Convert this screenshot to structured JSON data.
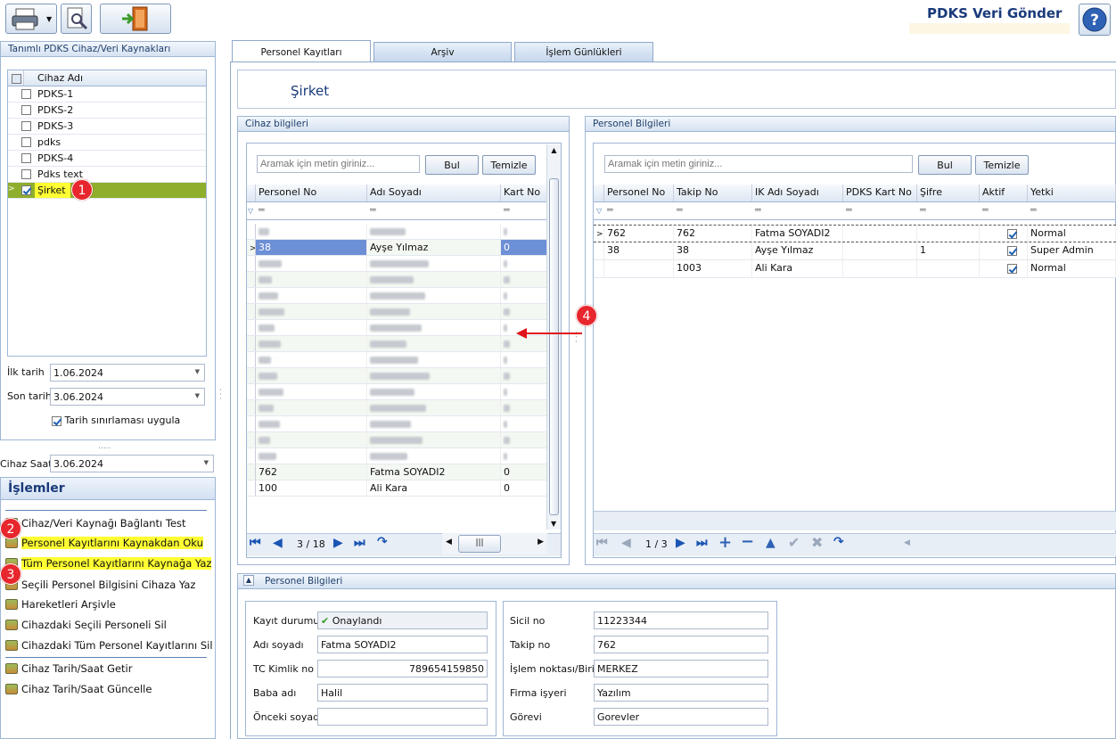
{
  "app_title": "PDKS Veri Gönder",
  "toolbar": {
    "print": "printer-icon",
    "preview": "print-preview-icon",
    "exit": "exit-door-icon",
    "help": "help-icon"
  },
  "left": {
    "panel_title": "Tanımlı PDKS Cihaz/Veri Kaynakları",
    "col_header": "Cihaz Adı",
    "devices": [
      {
        "name": "PDKS-1",
        "checked": false
      },
      {
        "name": "PDKS-2",
        "checked": false
      },
      {
        "name": "PDKS-3",
        "checked": false
      },
      {
        "name": "pdks",
        "checked": false
      },
      {
        "name": "PDKS-4",
        "checked": false
      },
      {
        "name": "Pdks text",
        "checked": false
      },
      {
        "name": "Şirket",
        "checked": true
      }
    ],
    "first_date_label": "İlk tarih",
    "first_date": "1.06.2024",
    "last_date_label": "Son tarih",
    "last_date": "3.06.2024",
    "date_limit_label": "Tarih sınırlaması uygula",
    "device_time_label": "Cihaz Saati",
    "device_time": "3.06.2024",
    "ops_title": "İşlemler",
    "ops": [
      "Cihaz/Veri Kaynağı Bağlantı Test",
      "Personel Kayıtlarını Kaynakdan Oku",
      "Tüm Personel Kayıtlarını Kaynağa Yaz",
      "Seçili Personel Bilgisini Cihaza Yaz",
      "Hareketleri Arşivle",
      "Cihazdaki Seçili Personeli Sil",
      "Cihazdaki Tüm Personel Kayıtlarını Sil",
      "Cihaz Tarih/Saat Getir",
      "Cihaz Tarih/Saat Güncelle"
    ]
  },
  "tabs": [
    "Personel Kayıtları",
    "Arşiv",
    "İşlem Günlükleri"
  ],
  "company": "Şirket",
  "device_panel": {
    "title": "Cihaz bilgileri",
    "search_placeholder": "Aramak için metin giriniz...",
    "find": "Bul",
    "clear": "Temizle",
    "cols": [
      "Personel No",
      "Adı Soyadı",
      "Kart No"
    ],
    "rows": [
      {
        "no": "38",
        "name": "Ayşe Yılmaz",
        "card": "0"
      },
      {
        "no": "762",
        "name": "Fatma SOYADI2",
        "card": "0"
      },
      {
        "no": "100",
        "name": "Ali Kara",
        "card": "0"
      }
    ],
    "nav": "3 / 18"
  },
  "person_panel": {
    "title": "Personel Bilgileri",
    "search_placeholder": "Aramak için metin giriniz...",
    "find": "Bul",
    "clear": "Temizle",
    "cols": [
      "Personel No",
      "Takip No",
      "IK Adı Soyadı",
      "PDKS Kart No",
      "Şifre",
      "Aktif",
      "Yetki"
    ],
    "rows": [
      {
        "no": "762",
        "track": "762",
        "name": "Fatma SOYADI2",
        "card": "",
        "pw": "",
        "active": true,
        "role": "Normal"
      },
      {
        "no": "38",
        "track": "38",
        "name": "Ayşe Yılmaz",
        "card": "",
        "pw": "1",
        "active": true,
        "role": "Super Admin"
      },
      {
        "no": "",
        "track": "1003",
        "name": "Ali Kara",
        "card": "",
        "pw": "",
        "active": true,
        "role": "Normal"
      }
    ],
    "nav": "1 / 3"
  },
  "details": {
    "title": "Personel Bilgileri",
    "status_label": "Kayıt durumu",
    "status": "Onaylandı",
    "name_label": "Adı soyadı",
    "name": "Fatma SOYADI2",
    "tc_label": "TC Kimlik no",
    "tc": "789654159850",
    "father_label": "Baba adı",
    "father": "Halil",
    "prev_label": "Önceki soyadı",
    "prev": "",
    "reg_label": "Sicil no",
    "reg": "11223344",
    "track_label": "Takip no",
    "track": "762",
    "unit_label": "İşlem noktası/Birim",
    "unit": "MERKEZ",
    "company_label": "Firma işyeri",
    "company": "Yazılım",
    "job_label": "Görevi",
    "job": "Gorevler"
  },
  "badges": [
    "1",
    "2",
    "3",
    "4"
  ]
}
